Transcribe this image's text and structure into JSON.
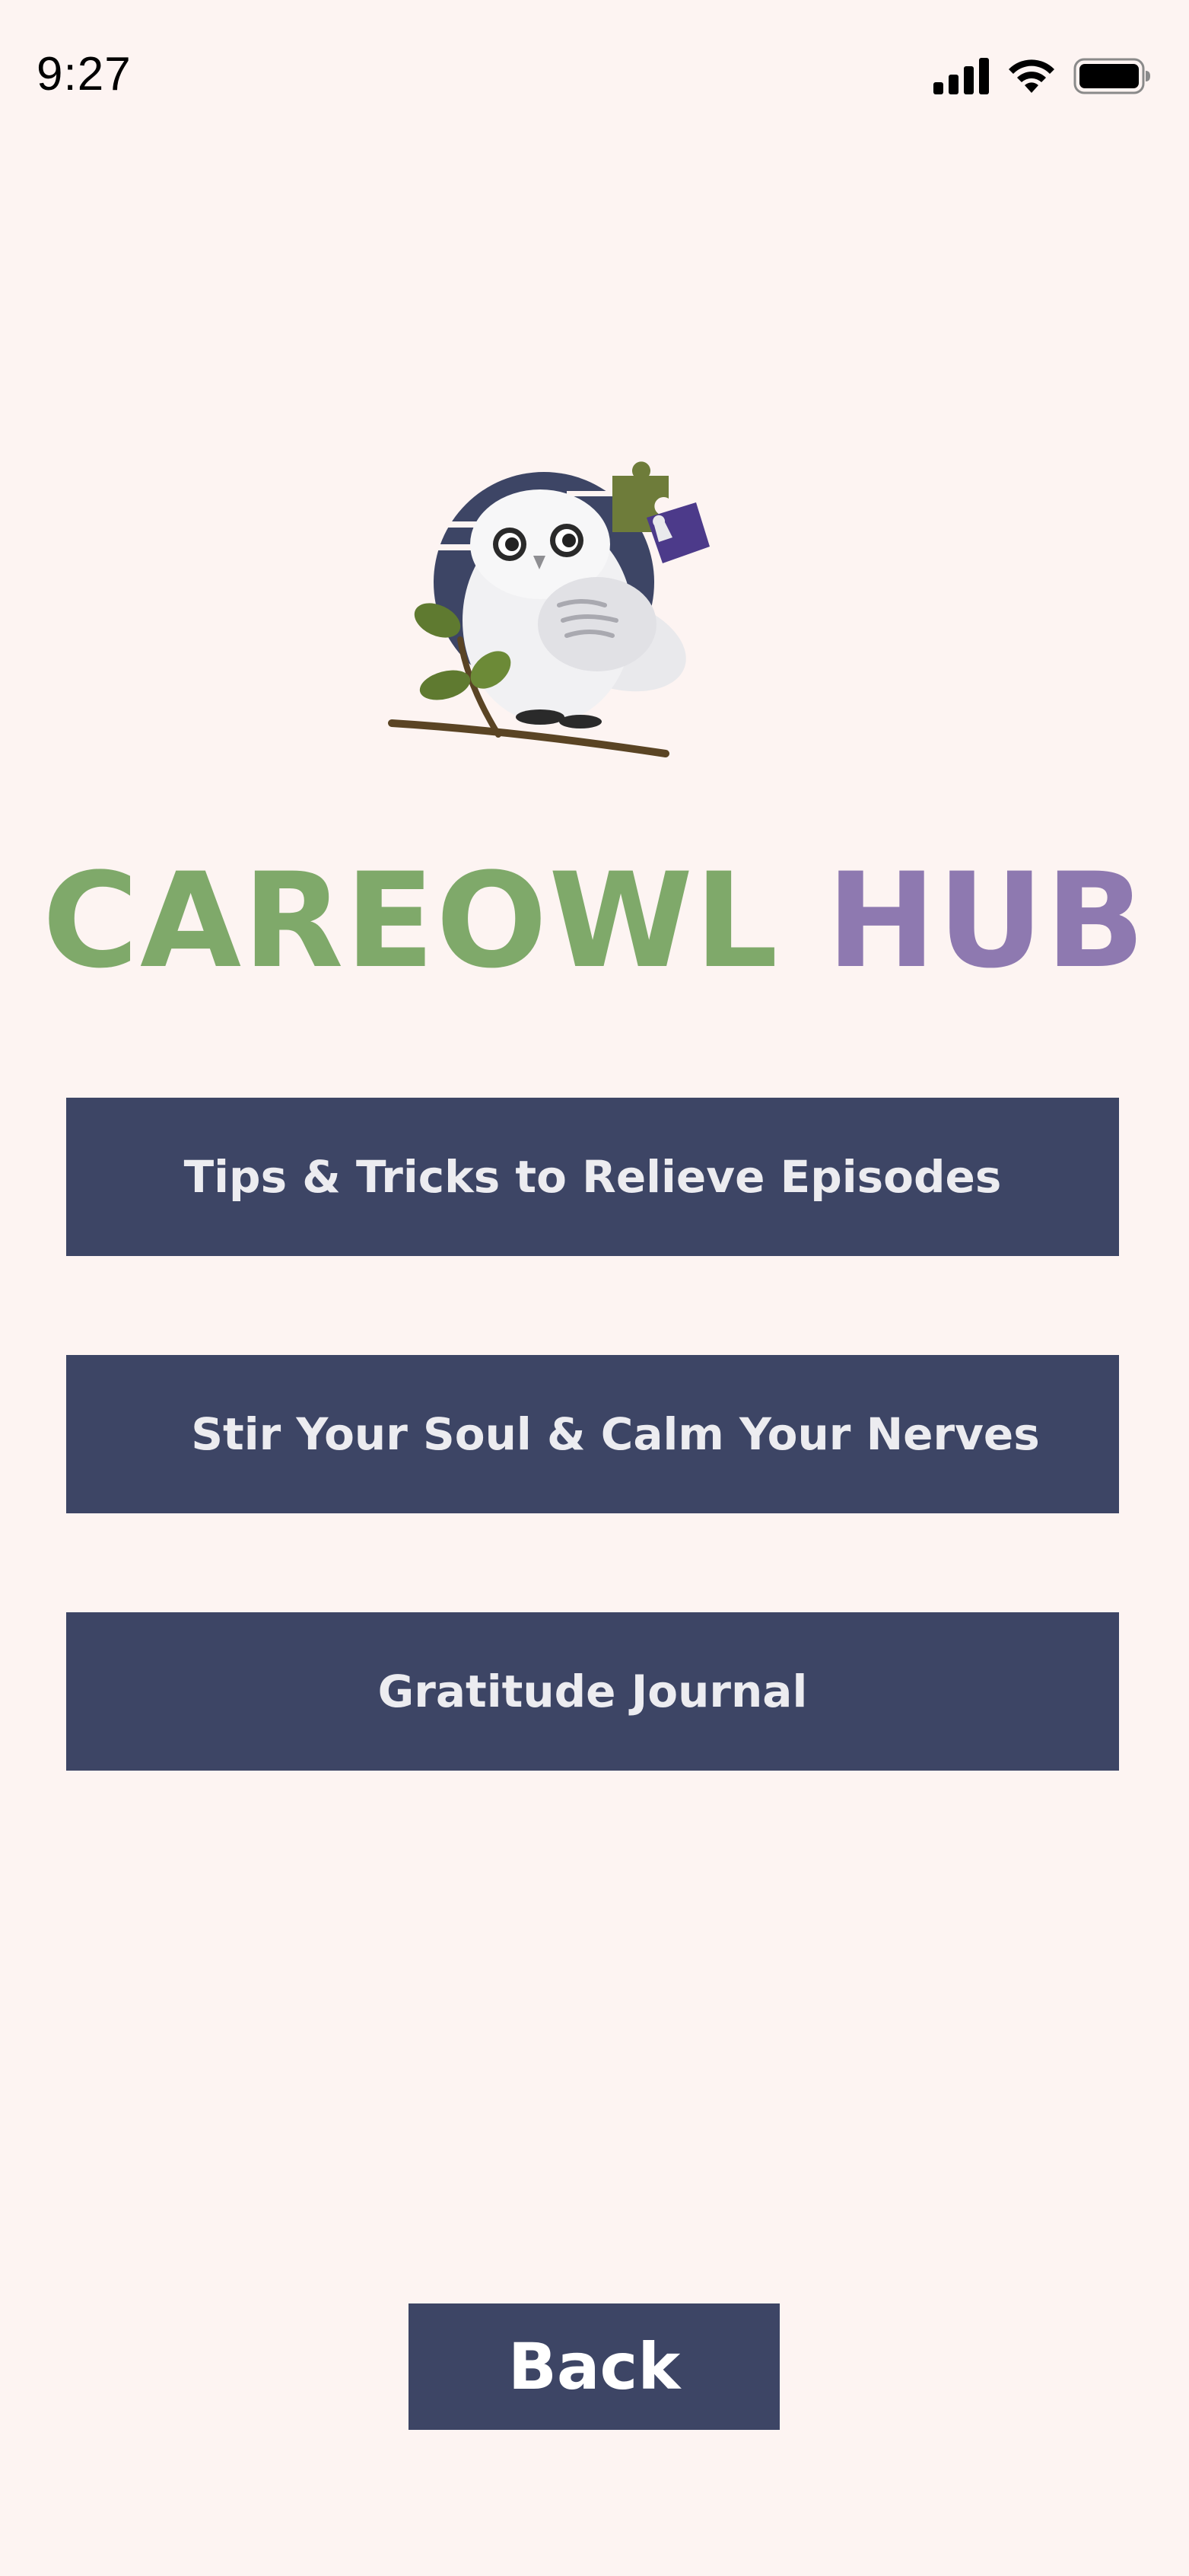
{
  "status_bar": {
    "time": "9:27",
    "icons": [
      "cellular-signal-icon",
      "wifi-icon",
      "battery-icon"
    ]
  },
  "logo": {
    "icon": "owl-logo-icon"
  },
  "title": {
    "word1": "CAREOWL",
    "word2": "HUB",
    "color1": "#7fa96a",
    "color2": "#8e79b0"
  },
  "menu": {
    "items": [
      {
        "label": "Tips & Tricks to Relieve Episodes"
      },
      {
        "label": "Stir Your Soul & Calm Your Nerves"
      },
      {
        "label": "Gratitude Journal"
      }
    ]
  },
  "footer": {
    "back_label": "Back"
  },
  "colors": {
    "background": "#fdf4f2",
    "button": "#3d4565",
    "button_text": "#ececf0"
  }
}
